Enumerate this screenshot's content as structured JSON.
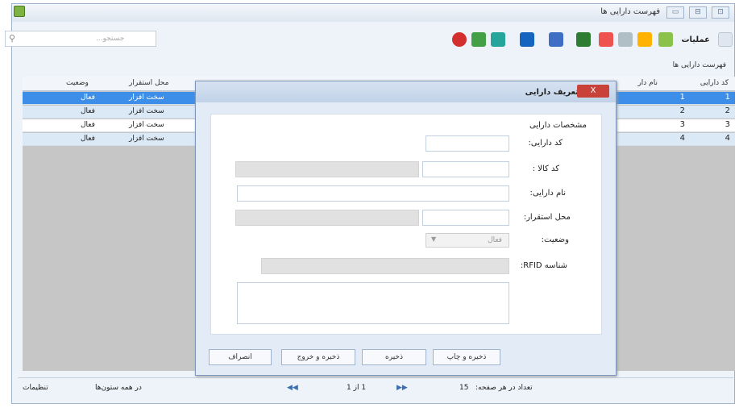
{
  "window": {
    "title": "فهرست دارایی ها",
    "controls": [
      "▭",
      "⊟",
      "⊡"
    ]
  },
  "search": {
    "placeholder": "جستجو..."
  },
  "toolbar": {
    "operations_label": "عملیات"
  },
  "list_label": "فهرست دارایی ها",
  "grid": {
    "headers": {
      "code": "کد دارایی",
      "name": "نام دار",
      "location": "محل استقرار",
      "status": "وضعیت"
    },
    "rows": [
      {
        "code": "1",
        "index": "1",
        "location": "سخت افزار",
        "status": "فعال"
      },
      {
        "code": "2",
        "index": "2",
        "location": "سخت افزار",
        "status": "فعال"
      },
      {
        "code": "3",
        "index": "3",
        "location": "سخت افزار",
        "status": "فعال"
      },
      {
        "code": "4",
        "index": "4",
        "location": "سخت افزار",
        "status": "فعال"
      }
    ]
  },
  "status_bar": {
    "settings": "تنظیمات",
    "search_all_cols": "در همه ستون‌ها",
    "page_info": "1 از 1",
    "page_size_label": "تعداد در هر صفحه:",
    "page_size": "15"
  },
  "dialog": {
    "title": "تعریف دارایی",
    "close": "X",
    "section": "مشخصات دارایی",
    "labels": {
      "asset_code": "کد دارایی:",
      "item_code": "کد کالا :",
      "asset_name": "نام دارایی:",
      "location": "محل استقرار:",
      "status": "وضعیت:",
      "rfid": "شناسه RFID:"
    },
    "status_value": "فعال",
    "buttons": {
      "save_print": "ذخیره و چاپ",
      "save": "ذخیره",
      "save_exit": "ذخیره و خروج",
      "cancel": "انصراف"
    }
  },
  "colors": {
    "selected_row": "#3d8ee8",
    "alt_row": "#dbe8f6",
    "grid_bg": "#c6c6c6"
  }
}
